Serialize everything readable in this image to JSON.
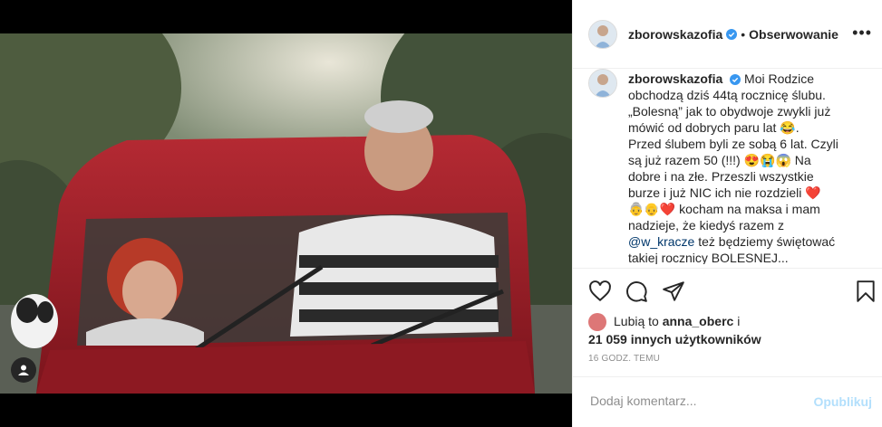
{
  "post": {
    "username": "zborowskazofia",
    "dot": "•",
    "follow_label": "Obserwowanie",
    "more_label": "•••",
    "caption_lines": [
      "Moi Rodzice",
      "obchodzą dziś 44tą rocznicę ślubu.",
      "„Bolesną” jak to obydwoje zwykli już",
      "mówić od dobrych paru lat 😂.",
      "Przed ślubem byli ze sobą 6 lat. Czyli",
      "są już razem 50 (!!!) 😍😭😱 Na",
      "dobre i na złe. Przeszli wszystkie",
      "burze i już NIC ich nie rozdzieli ❤️",
      "👵👴❤️ kocham na maksa i mam",
      "nadzieje, że kiedyś razem z",
      "",
      "takiej rocznicy BOLESNEJ..."
    ],
    "mention": "@w_kracze",
    "mention_tail": " też będziemy świętować",
    "likes_prefix": "Lubią to ",
    "likes_user": "anna_oberc",
    "likes_and": " i",
    "likes_count": "21 059 innych użytkowników",
    "time_ago": "16 GODZ. TEMU",
    "comment_placeholder": "Dodaj komentarz...",
    "publish_label": "Opublikuj"
  },
  "colors": {
    "verified": "#3897f0",
    "link": "#00376b",
    "muted": "#8e8e8e",
    "publish_disabled": "#b2dffc",
    "car_red": "#a3202a"
  }
}
